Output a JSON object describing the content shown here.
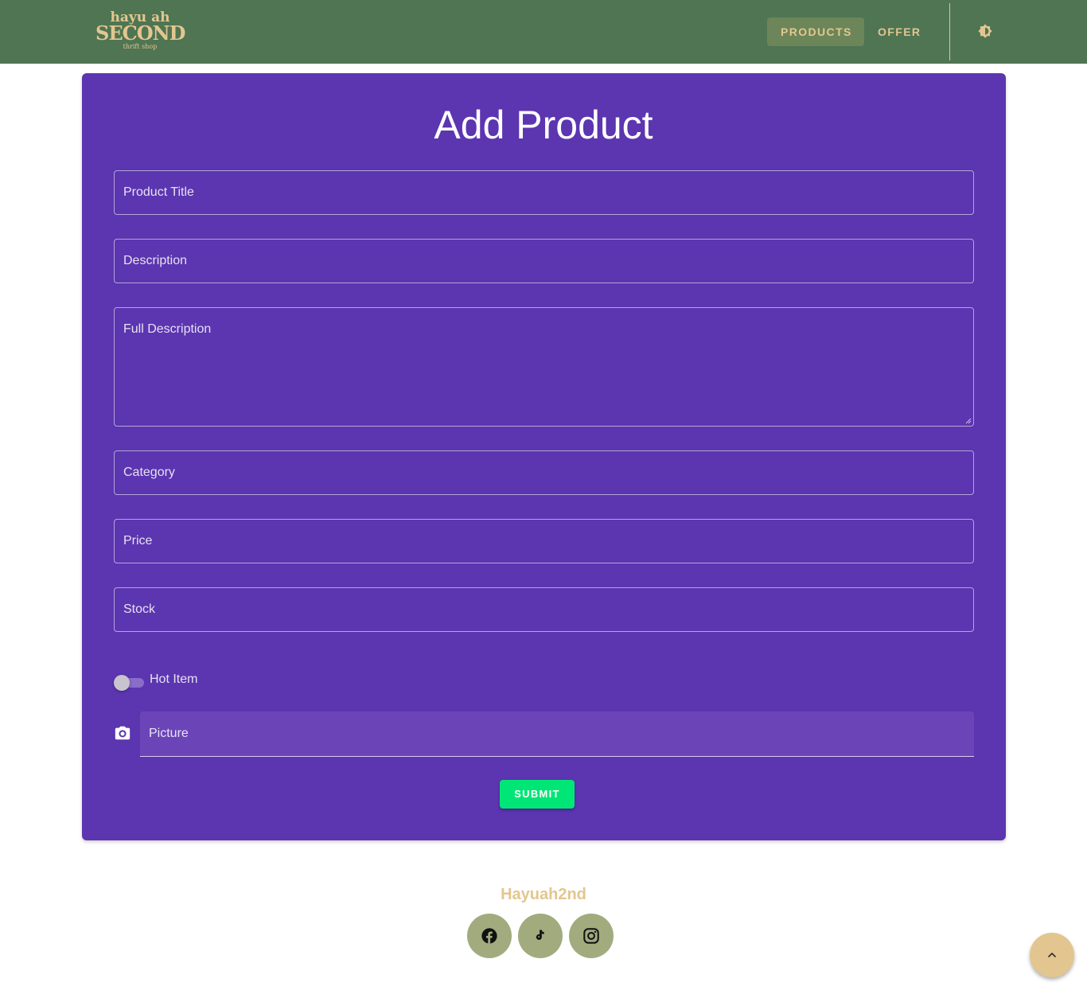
{
  "header": {
    "logo": {
      "line1": "hayu ah",
      "line2": "SECOND",
      "line3": "thrift shop"
    },
    "nav": [
      {
        "label": "PRODUCTS"
      },
      {
        "label": "OFFER"
      }
    ],
    "theme_toggle_icon": "theme-toggle-icon"
  },
  "form": {
    "title": "Add Product",
    "fields": {
      "product_title": {
        "label": "Product Title"
      },
      "description": {
        "label": "Description"
      },
      "full_description": {
        "label": "Full Description"
      },
      "category": {
        "label": "Category"
      },
      "price": {
        "label": "Price"
      },
      "stock": {
        "label": "Stock"
      }
    },
    "hot_item": {
      "label": "Hot Item",
      "checked": false
    },
    "picture": {
      "label": "Picture",
      "icon": "camera-icon"
    },
    "submit_label": "SUBMIT"
  },
  "footer": {
    "brand": "Hayuah2nd",
    "social": [
      {
        "icon": "facebook-icon"
      },
      {
        "icon": "tiktok-icon"
      },
      {
        "icon": "instagram-icon"
      }
    ]
  },
  "scroll_top_icon": "chevron-up-icon",
  "colors": {
    "header_bg": "#4f7553",
    "accent_gold": "#e3c68f",
    "card_bg": "#5c35b0",
    "submit_bg": "#00e676",
    "social_bg": "#a1ab7e"
  }
}
